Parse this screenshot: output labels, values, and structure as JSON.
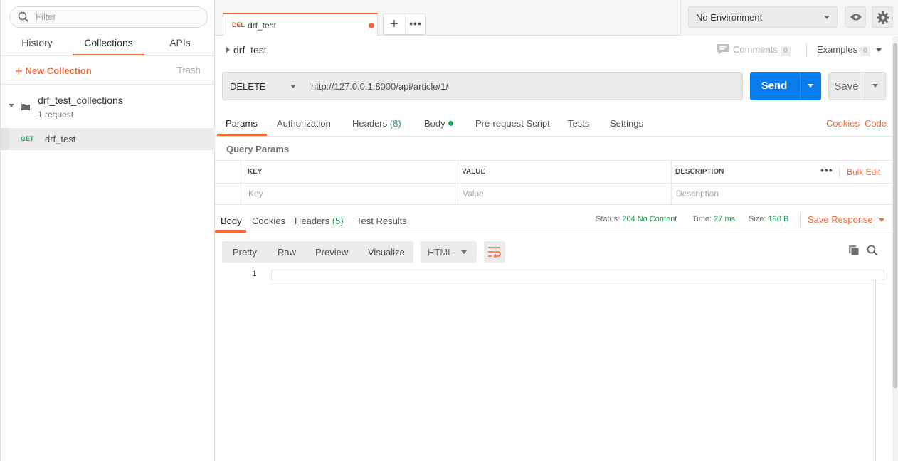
{
  "sidebar": {
    "filter_placeholder": "Filter",
    "tabs": [
      {
        "label": "History"
      },
      {
        "label": "Collections",
        "active": true
      },
      {
        "label": "APIs"
      }
    ],
    "new_collection_label": "New Collection",
    "trash_label": "Trash",
    "collection": {
      "name": "drf_test_collections",
      "meta": "1 request"
    },
    "request": {
      "method": "GET",
      "name": "drf_test"
    }
  },
  "topbar": {
    "tab": {
      "method": "DEL",
      "name": "drf_test"
    },
    "environment": "No Environment"
  },
  "request": {
    "title": "drf_test",
    "comments_label": "Comments",
    "comments_count": "0",
    "examples_label": "Examples",
    "examples_count": "0",
    "method": "DELETE",
    "url": "http://127.0.0.1:8000/api/article/1/",
    "send_label": "Send",
    "save_label": "Save",
    "tabs": {
      "params": "Params",
      "authorization": "Authorization",
      "headers": "Headers",
      "headers_count": "(8)",
      "body": "Body",
      "pre_request": "Pre-request Script",
      "tests": "Tests",
      "settings": "Settings"
    },
    "cookies_link": "Cookies",
    "code_link": "Code"
  },
  "query_params": {
    "title": "Query Params",
    "headers": {
      "key": "KEY",
      "value": "VALUE",
      "description": "DESCRIPTION"
    },
    "placeholders": {
      "key": "Key",
      "value": "Value",
      "description": "Description"
    },
    "bulk_edit": "Bulk Edit"
  },
  "response": {
    "tabs": {
      "body": "Body",
      "cookies": "Cookies",
      "headers": "Headers",
      "headers_count": "(5)",
      "test_results": "Test Results"
    },
    "status_label": "Status:",
    "status_value": "204 No Content",
    "time_label": "Time:",
    "time_value": "27 ms",
    "size_label": "Size:",
    "size_value": "190 B",
    "save_response": "Save Response",
    "views": [
      "Pretty",
      "Raw",
      "Preview",
      "Visualize"
    ],
    "format": "HTML",
    "line_number": "1"
  },
  "colors": {
    "accent": "#f26b3a",
    "primary": "#097bed",
    "success": "#1f9d55"
  },
  "icons": [
    "search-icon",
    "folder-icon",
    "plus-icon",
    "more-icon",
    "eye-icon",
    "gear-icon",
    "comment-icon",
    "wrap-icon",
    "copy-icon"
  ]
}
